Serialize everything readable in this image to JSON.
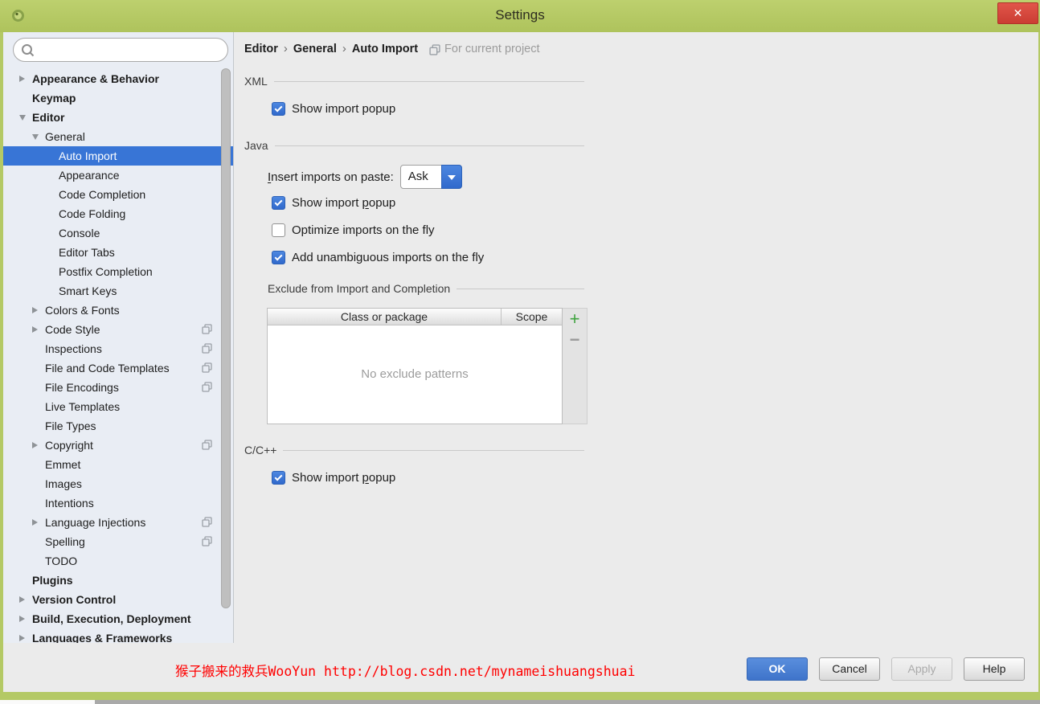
{
  "window": {
    "title": "Settings",
    "close_glyph": "✕"
  },
  "colors": {
    "titlebar": "#b4c965",
    "selection": "#3875d6",
    "checkbox_accent": "#3e79d9",
    "close_button": "#d9453a",
    "watermark": "#ff0000",
    "add_button": "#3fa33f"
  },
  "sidebar": {
    "search": {
      "placeholder": ""
    },
    "items": [
      {
        "label": "Appearance & Behavior",
        "bold": true,
        "indent": 0,
        "arrow": "right",
        "per_project": false,
        "selected": false
      },
      {
        "label": "Keymap",
        "bold": true,
        "indent": 0,
        "arrow": null,
        "per_project": false,
        "selected": false
      },
      {
        "label": "Editor",
        "bold": true,
        "indent": 0,
        "arrow": "down",
        "per_project": false,
        "selected": false
      },
      {
        "label": "General",
        "bold": false,
        "indent": 1,
        "arrow": "down",
        "per_project": false,
        "selected": false
      },
      {
        "label": "Auto Import",
        "bold": false,
        "indent": 2,
        "arrow": null,
        "per_project": false,
        "selected": true
      },
      {
        "label": "Appearance",
        "bold": false,
        "indent": 2,
        "arrow": null,
        "per_project": false,
        "selected": false
      },
      {
        "label": "Code Completion",
        "bold": false,
        "indent": 2,
        "arrow": null,
        "per_project": false,
        "selected": false
      },
      {
        "label": "Code Folding",
        "bold": false,
        "indent": 2,
        "arrow": null,
        "per_project": false,
        "selected": false
      },
      {
        "label": "Console",
        "bold": false,
        "indent": 2,
        "arrow": null,
        "per_project": false,
        "selected": false
      },
      {
        "label": "Editor Tabs",
        "bold": false,
        "indent": 2,
        "arrow": null,
        "per_project": false,
        "selected": false
      },
      {
        "label": "Postfix Completion",
        "bold": false,
        "indent": 2,
        "arrow": null,
        "per_project": false,
        "selected": false
      },
      {
        "label": "Smart Keys",
        "bold": false,
        "indent": 2,
        "arrow": null,
        "per_project": false,
        "selected": false
      },
      {
        "label": "Colors & Fonts",
        "bold": false,
        "indent": 1,
        "arrow": "right",
        "per_project": false,
        "selected": false
      },
      {
        "label": "Code Style",
        "bold": false,
        "indent": 1,
        "arrow": "right",
        "per_project": true,
        "selected": false
      },
      {
        "label": "Inspections",
        "bold": false,
        "indent": 1,
        "arrow": null,
        "per_project": true,
        "selected": false
      },
      {
        "label": "File and Code Templates",
        "bold": false,
        "indent": 1,
        "arrow": null,
        "per_project": true,
        "selected": false
      },
      {
        "label": "File Encodings",
        "bold": false,
        "indent": 1,
        "arrow": null,
        "per_project": true,
        "selected": false
      },
      {
        "label": "Live Templates",
        "bold": false,
        "indent": 1,
        "arrow": null,
        "per_project": false,
        "selected": false
      },
      {
        "label": "File Types",
        "bold": false,
        "indent": 1,
        "arrow": null,
        "per_project": false,
        "selected": false
      },
      {
        "label": "Copyright",
        "bold": false,
        "indent": 1,
        "arrow": "right",
        "per_project": true,
        "selected": false
      },
      {
        "label": "Emmet",
        "bold": false,
        "indent": 1,
        "arrow": null,
        "per_project": false,
        "selected": false
      },
      {
        "label": "Images",
        "bold": false,
        "indent": 1,
        "arrow": null,
        "per_project": false,
        "selected": false
      },
      {
        "label": "Intentions",
        "bold": false,
        "indent": 1,
        "arrow": null,
        "per_project": false,
        "selected": false
      },
      {
        "label": "Language Injections",
        "bold": false,
        "indent": 1,
        "arrow": "right",
        "per_project": true,
        "selected": false
      },
      {
        "label": "Spelling",
        "bold": false,
        "indent": 1,
        "arrow": null,
        "per_project": true,
        "selected": false
      },
      {
        "label": "TODO",
        "bold": false,
        "indent": 1,
        "arrow": null,
        "per_project": false,
        "selected": false
      },
      {
        "label": "Plugins",
        "bold": true,
        "indent": 0,
        "arrow": null,
        "per_project": false,
        "selected": false
      },
      {
        "label": "Version Control",
        "bold": true,
        "indent": 0,
        "arrow": "right",
        "per_project": false,
        "selected": false
      },
      {
        "label": "Build, Execution, Deployment",
        "bold": true,
        "indent": 0,
        "arrow": "right",
        "per_project": false,
        "selected": false
      },
      {
        "label": "Languages & Frameworks",
        "bold": true,
        "indent": 0,
        "arrow": "right",
        "per_project": false,
        "selected": false
      }
    ]
  },
  "main": {
    "breadcrumb": {
      "items": [
        "Editor",
        "General",
        "Auto Import"
      ],
      "separator": "›",
      "context_label": "For current project"
    },
    "xml_section": {
      "title": "XML",
      "show_import_popup": {
        "text": "Show import popup"
      },
      "show_import_popup_checked": true
    },
    "java_section": {
      "title": "Java",
      "insert_imports_label": {
        "text": "Insert imports on paste:",
        "mnemonic_index": 0
      },
      "insert_imports_value": "Ask",
      "show_import_popup": {
        "text": "Show import popup",
        "mnemonic_index": 12
      },
      "show_import_popup_checked": true,
      "optimize_imports": {
        "text": "Optimize imports on the fly"
      },
      "optimize_imports_checked": false,
      "add_unambiguous": {
        "text": "Add unambiguous imports on the fly"
      },
      "add_unambiguous_checked": true,
      "exclude": {
        "title": "Exclude from Import and Completion",
        "columns": [
          "Class or package",
          "Scope"
        ],
        "empty_text": "No exclude patterns",
        "add_glyph": "+",
        "remove_glyph": "−"
      }
    },
    "cpp_section": {
      "title": "C/C++",
      "show_import_popup": {
        "text": "Show import popup",
        "mnemonic_index": 12
      },
      "show_import_popup_checked": true
    }
  },
  "footer": {
    "watermark": "猴子搬来的救兵WooYun http://blog.csdn.net/mynameishuangshuai",
    "buttons": [
      {
        "label": "OK",
        "role": "ok",
        "state": "primary"
      },
      {
        "label": "Cancel",
        "role": "cancel",
        "state": "normal"
      },
      {
        "label": "Apply",
        "role": "apply",
        "state": "disabled"
      },
      {
        "label": "Help",
        "role": "help",
        "state": "normal"
      }
    ]
  }
}
